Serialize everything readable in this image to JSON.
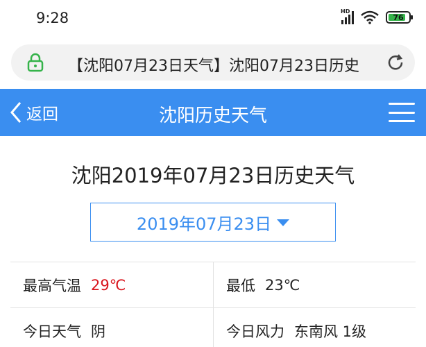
{
  "status_bar": {
    "time": "9:28",
    "network": "HD",
    "battery": "76",
    "battery_color": "#35b34a"
  },
  "browser": {
    "address": "【沈阳07月23日天气】沈阳07月23日历史",
    "lock_icon": "lock-icon",
    "reload_icon": "reload-icon"
  },
  "header": {
    "back_label": "返回",
    "title": "沈阳历史天气",
    "background": "#3a8ef0"
  },
  "main": {
    "title": "沈阳2019年07月23日历史天气",
    "date_select": "2019年07月23日"
  },
  "weather": {
    "high_label": "最高气温",
    "high_value": "29℃",
    "low_label": "最低",
    "low_value": "23℃",
    "condition_label": "今日天气",
    "condition_value": "阴",
    "wind_label": "今日风力",
    "wind_value": "东南风 1级",
    "high_color": "#d9141c"
  }
}
